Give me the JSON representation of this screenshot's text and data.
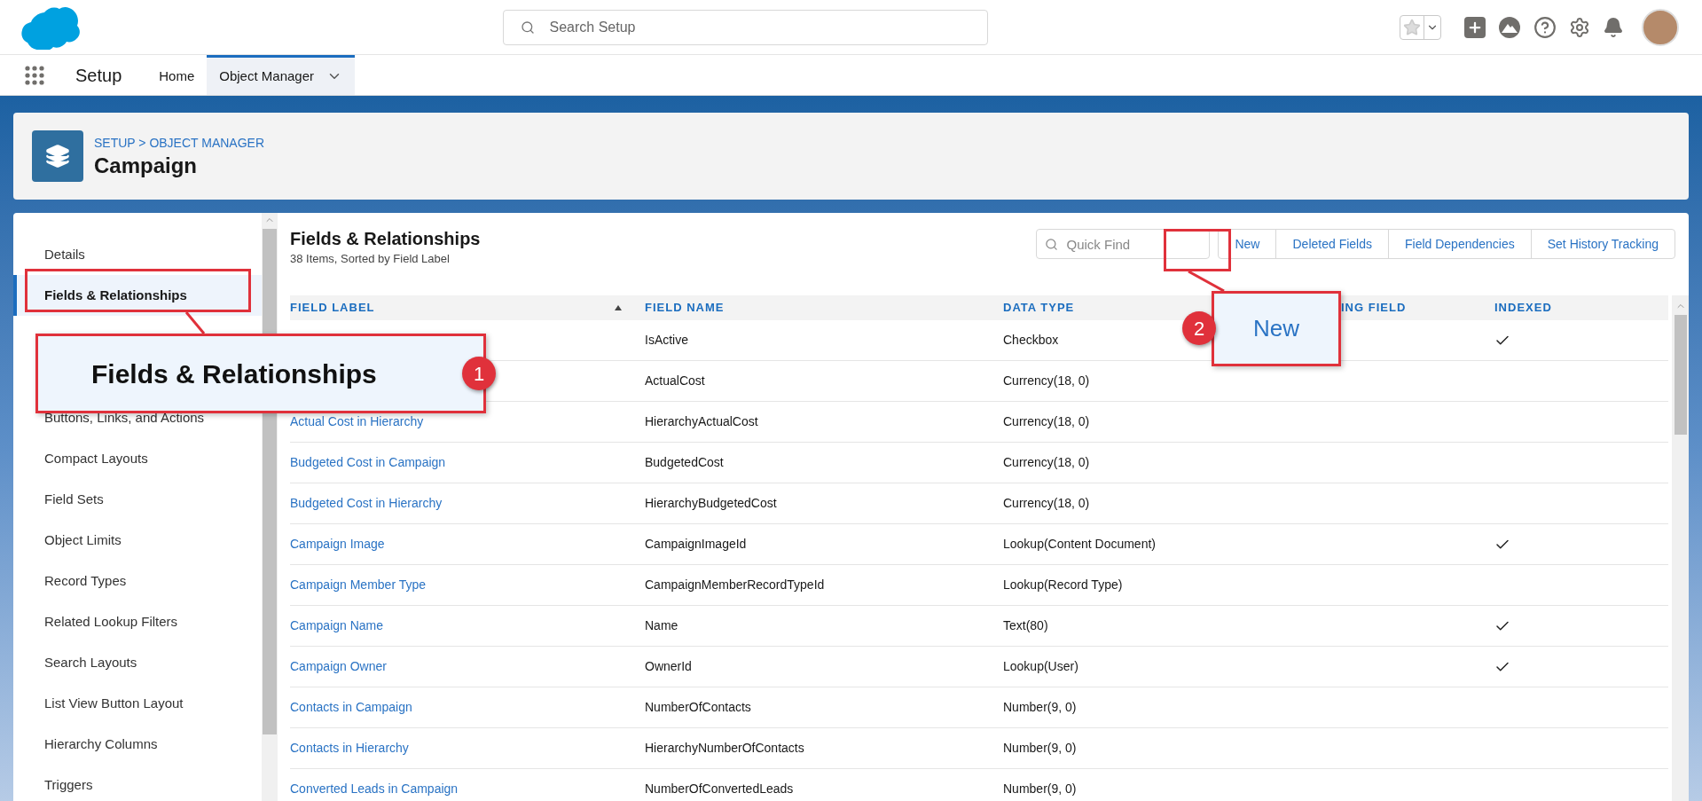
{
  "top_bar": {
    "search": {
      "placeholder": "Search Setup"
    }
  },
  "nav": {
    "app_name": "Setup",
    "tabs": [
      {
        "label": "Home",
        "selected": false,
        "has_menu": false
      },
      {
        "label": "Object Manager",
        "selected": true,
        "has_menu": true
      }
    ]
  },
  "header": {
    "breadcrumb": "SETUP > OBJECT MANAGER",
    "title": "Campaign"
  },
  "sidebar": {
    "items": [
      {
        "label": "Details",
        "selected": false
      },
      {
        "label": "Fields & Relationships",
        "selected": true
      },
      {
        "label": "Buttons, Links, and Actions",
        "selected": false
      },
      {
        "label": "Compact Layouts",
        "selected": false
      },
      {
        "label": "Field Sets",
        "selected": false
      },
      {
        "label": "Object Limits",
        "selected": false
      },
      {
        "label": "Record Types",
        "selected": false
      },
      {
        "label": "Related Lookup Filters",
        "selected": false
      },
      {
        "label": "Search Layouts",
        "selected": false
      },
      {
        "label": "List View Button Layout",
        "selected": false
      },
      {
        "label": "Hierarchy Columns",
        "selected": false
      },
      {
        "label": "Triggers",
        "selected": false
      }
    ]
  },
  "content": {
    "title": "Fields & Relationships",
    "subtitle": "38 Items, Sorted by Field Label",
    "quick_find": {
      "placeholder": "Quick Find"
    },
    "buttons": [
      "New",
      "Deleted Fields",
      "Field Dependencies",
      "Set History Tracking"
    ],
    "columns": [
      "FIELD LABEL",
      "FIELD NAME",
      "DATA TYPE",
      "ING FIELD",
      "INDEXED"
    ],
    "rows": [
      {
        "name": "IsActive",
        "type": "Checkbox",
        "indexed": true
      },
      {
        "name": "ActualCost",
        "type": "Currency(18, 0)",
        "indexed": false
      },
      {
        "label": "Actual Cost in Hierarchy",
        "name": "HierarchyActualCost",
        "type": "Currency(18, 0)",
        "indexed": false
      },
      {
        "label": "Budgeted Cost in Campaign",
        "name": "BudgetedCost",
        "type": "Currency(18, 0)",
        "indexed": false
      },
      {
        "label": "Budgeted Cost in Hierarchy",
        "name": "HierarchyBudgetedCost",
        "type": "Currency(18, 0)",
        "indexed": false
      },
      {
        "label": "Campaign Image",
        "name": "CampaignImageId",
        "type": "Lookup(Content Document)",
        "indexed": true
      },
      {
        "label": "Campaign Member Type",
        "name": "CampaignMemberRecordTypeId",
        "type": "Lookup(Record Type)",
        "indexed": false
      },
      {
        "label": "Campaign Name",
        "name": "Name",
        "type": "Text(80)",
        "indexed": true
      },
      {
        "label": "Campaign Owner",
        "name": "OwnerId",
        "type": "Lookup(User)",
        "indexed": true
      },
      {
        "label": "Contacts in Campaign",
        "name": "NumberOfContacts",
        "type": "Number(9, 0)",
        "indexed": false
      },
      {
        "label": "Contacts in Hierarchy",
        "name": "HierarchyNumberOfContacts",
        "type": "Number(9, 0)",
        "indexed": false
      },
      {
        "label": "Converted Leads in Campaign",
        "name": "NumberOfConvertedLeads",
        "type": "Number(9, 0)",
        "indexed": false
      }
    ]
  },
  "callouts": [
    {
      "number": "1",
      "text": "Fields & Relationships"
    },
    {
      "number": "2",
      "text": "New"
    }
  ]
}
